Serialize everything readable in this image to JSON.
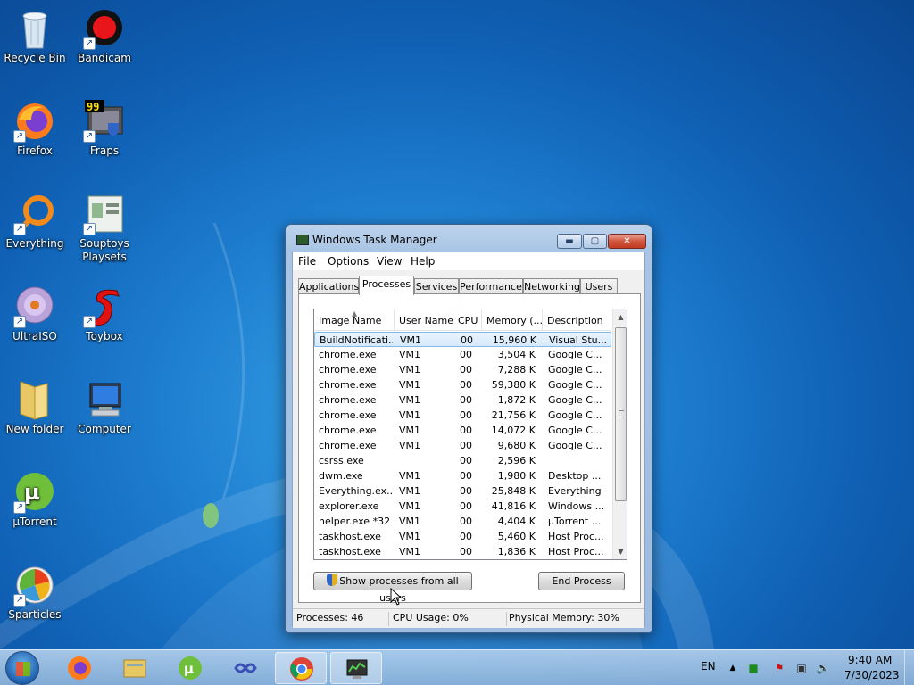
{
  "desktop": {
    "icons": [
      {
        "label": "Recycle Bin"
      },
      {
        "label": "Bandicam"
      },
      {
        "label": "Firefox"
      },
      {
        "label": "Fraps"
      },
      {
        "label": "Everything"
      },
      {
        "label": "Souptoys Playsets"
      },
      {
        "label": "UltraISO"
      },
      {
        "label": "Toybox"
      },
      {
        "label": "New folder"
      },
      {
        "label": "Computer"
      },
      {
        "label": "µTorrent"
      },
      {
        "label": "Sparticles"
      }
    ]
  },
  "window": {
    "title": "Windows Task Manager",
    "menu": [
      "File",
      "Options",
      "View",
      "Help"
    ],
    "tabs": [
      "Applications",
      "Processes",
      "Services",
      "Performance",
      "Networking",
      "Users"
    ],
    "active_tab": "Processes",
    "columns": [
      "Image Name",
      "User Name",
      "CPU",
      "Memory (...",
      "Description"
    ],
    "rows": [
      {
        "name": "BuildNotificati...",
        "user": "VM1",
        "cpu": "00",
        "mem": "15,960 K",
        "desc": "Visual Stu..."
      },
      {
        "name": "chrome.exe",
        "user": "VM1",
        "cpu": "00",
        "mem": "3,504 K",
        "desc": "Google C..."
      },
      {
        "name": "chrome.exe",
        "user": "VM1",
        "cpu": "00",
        "mem": "7,288 K",
        "desc": "Google C..."
      },
      {
        "name": "chrome.exe",
        "user": "VM1",
        "cpu": "00",
        "mem": "59,380 K",
        "desc": "Google C..."
      },
      {
        "name": "chrome.exe",
        "user": "VM1",
        "cpu": "00",
        "mem": "1,872 K",
        "desc": "Google C..."
      },
      {
        "name": "chrome.exe",
        "user": "VM1",
        "cpu": "00",
        "mem": "21,756 K",
        "desc": "Google C..."
      },
      {
        "name": "chrome.exe",
        "user": "VM1",
        "cpu": "00",
        "mem": "14,072 K",
        "desc": "Google C..."
      },
      {
        "name": "chrome.exe",
        "user": "VM1",
        "cpu": "00",
        "mem": "9,680 K",
        "desc": "Google C..."
      },
      {
        "name": "csrss.exe",
        "user": "",
        "cpu": "00",
        "mem": "2,596 K",
        "desc": ""
      },
      {
        "name": "dwm.exe",
        "user": "VM1",
        "cpu": "00",
        "mem": "1,980 K",
        "desc": "Desktop ..."
      },
      {
        "name": "Everything.ex...",
        "user": "VM1",
        "cpu": "00",
        "mem": "25,848 K",
        "desc": "Everything"
      },
      {
        "name": "explorer.exe",
        "user": "VM1",
        "cpu": "00",
        "mem": "41,816 K",
        "desc": "Windows ..."
      },
      {
        "name": "helper.exe *32",
        "user": "VM1",
        "cpu": "00",
        "mem": "4,404 K",
        "desc": "µTorrent ..."
      },
      {
        "name": "taskhost.exe",
        "user": "VM1",
        "cpu": "00",
        "mem": "5,460 K",
        "desc": "Host Proc..."
      },
      {
        "name": "taskhost.exe",
        "user": "VM1",
        "cpu": "00",
        "mem": "1,836 K",
        "desc": "Host Proc..."
      }
    ],
    "selected_row": 0,
    "buttons": {
      "show_all": "Show processes from all users",
      "end_process": "End Process"
    },
    "status": {
      "processes": "Processes: 46",
      "cpu": "CPU Usage: 0%",
      "memory": "Physical Memory: 30%"
    }
  },
  "taskbar": {
    "pinned": [
      {
        "icon": "firefox-icon"
      },
      {
        "icon": "explorer-icon"
      },
      {
        "icon": "utorrent-icon"
      },
      {
        "icon": "infinity-icon"
      },
      {
        "icon": "chrome-icon"
      },
      {
        "icon": "task-manager-icon"
      }
    ],
    "active_index": 4,
    "language": "EN",
    "time": "9:40 AM",
    "date": "7/30/2023"
  }
}
